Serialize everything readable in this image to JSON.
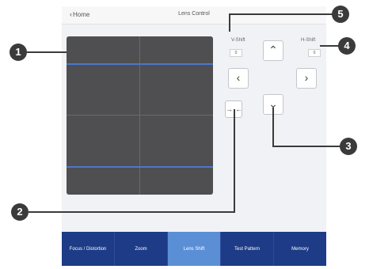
{
  "header": {
    "back_label": "Home",
    "title": "Lens Control"
  },
  "shift": {
    "v_label": "V-Shift",
    "v_value": "0",
    "h_label": "H-Shift",
    "h_value": "0"
  },
  "tabs": [
    {
      "label": "Focus / Distortion"
    },
    {
      "label": "Zoom"
    },
    {
      "label": "Lens Shift"
    },
    {
      "label": "Test Pattern"
    },
    {
      "label": "Memory"
    }
  ],
  "callouts": [
    "1",
    "2",
    "3",
    "4",
    "5"
  ],
  "colors": {
    "tab_bar": "#1d3b86",
    "tab_active": "#5a8fd6",
    "guide_line": "#4a77c9",
    "callout": "#3b3b3b"
  }
}
